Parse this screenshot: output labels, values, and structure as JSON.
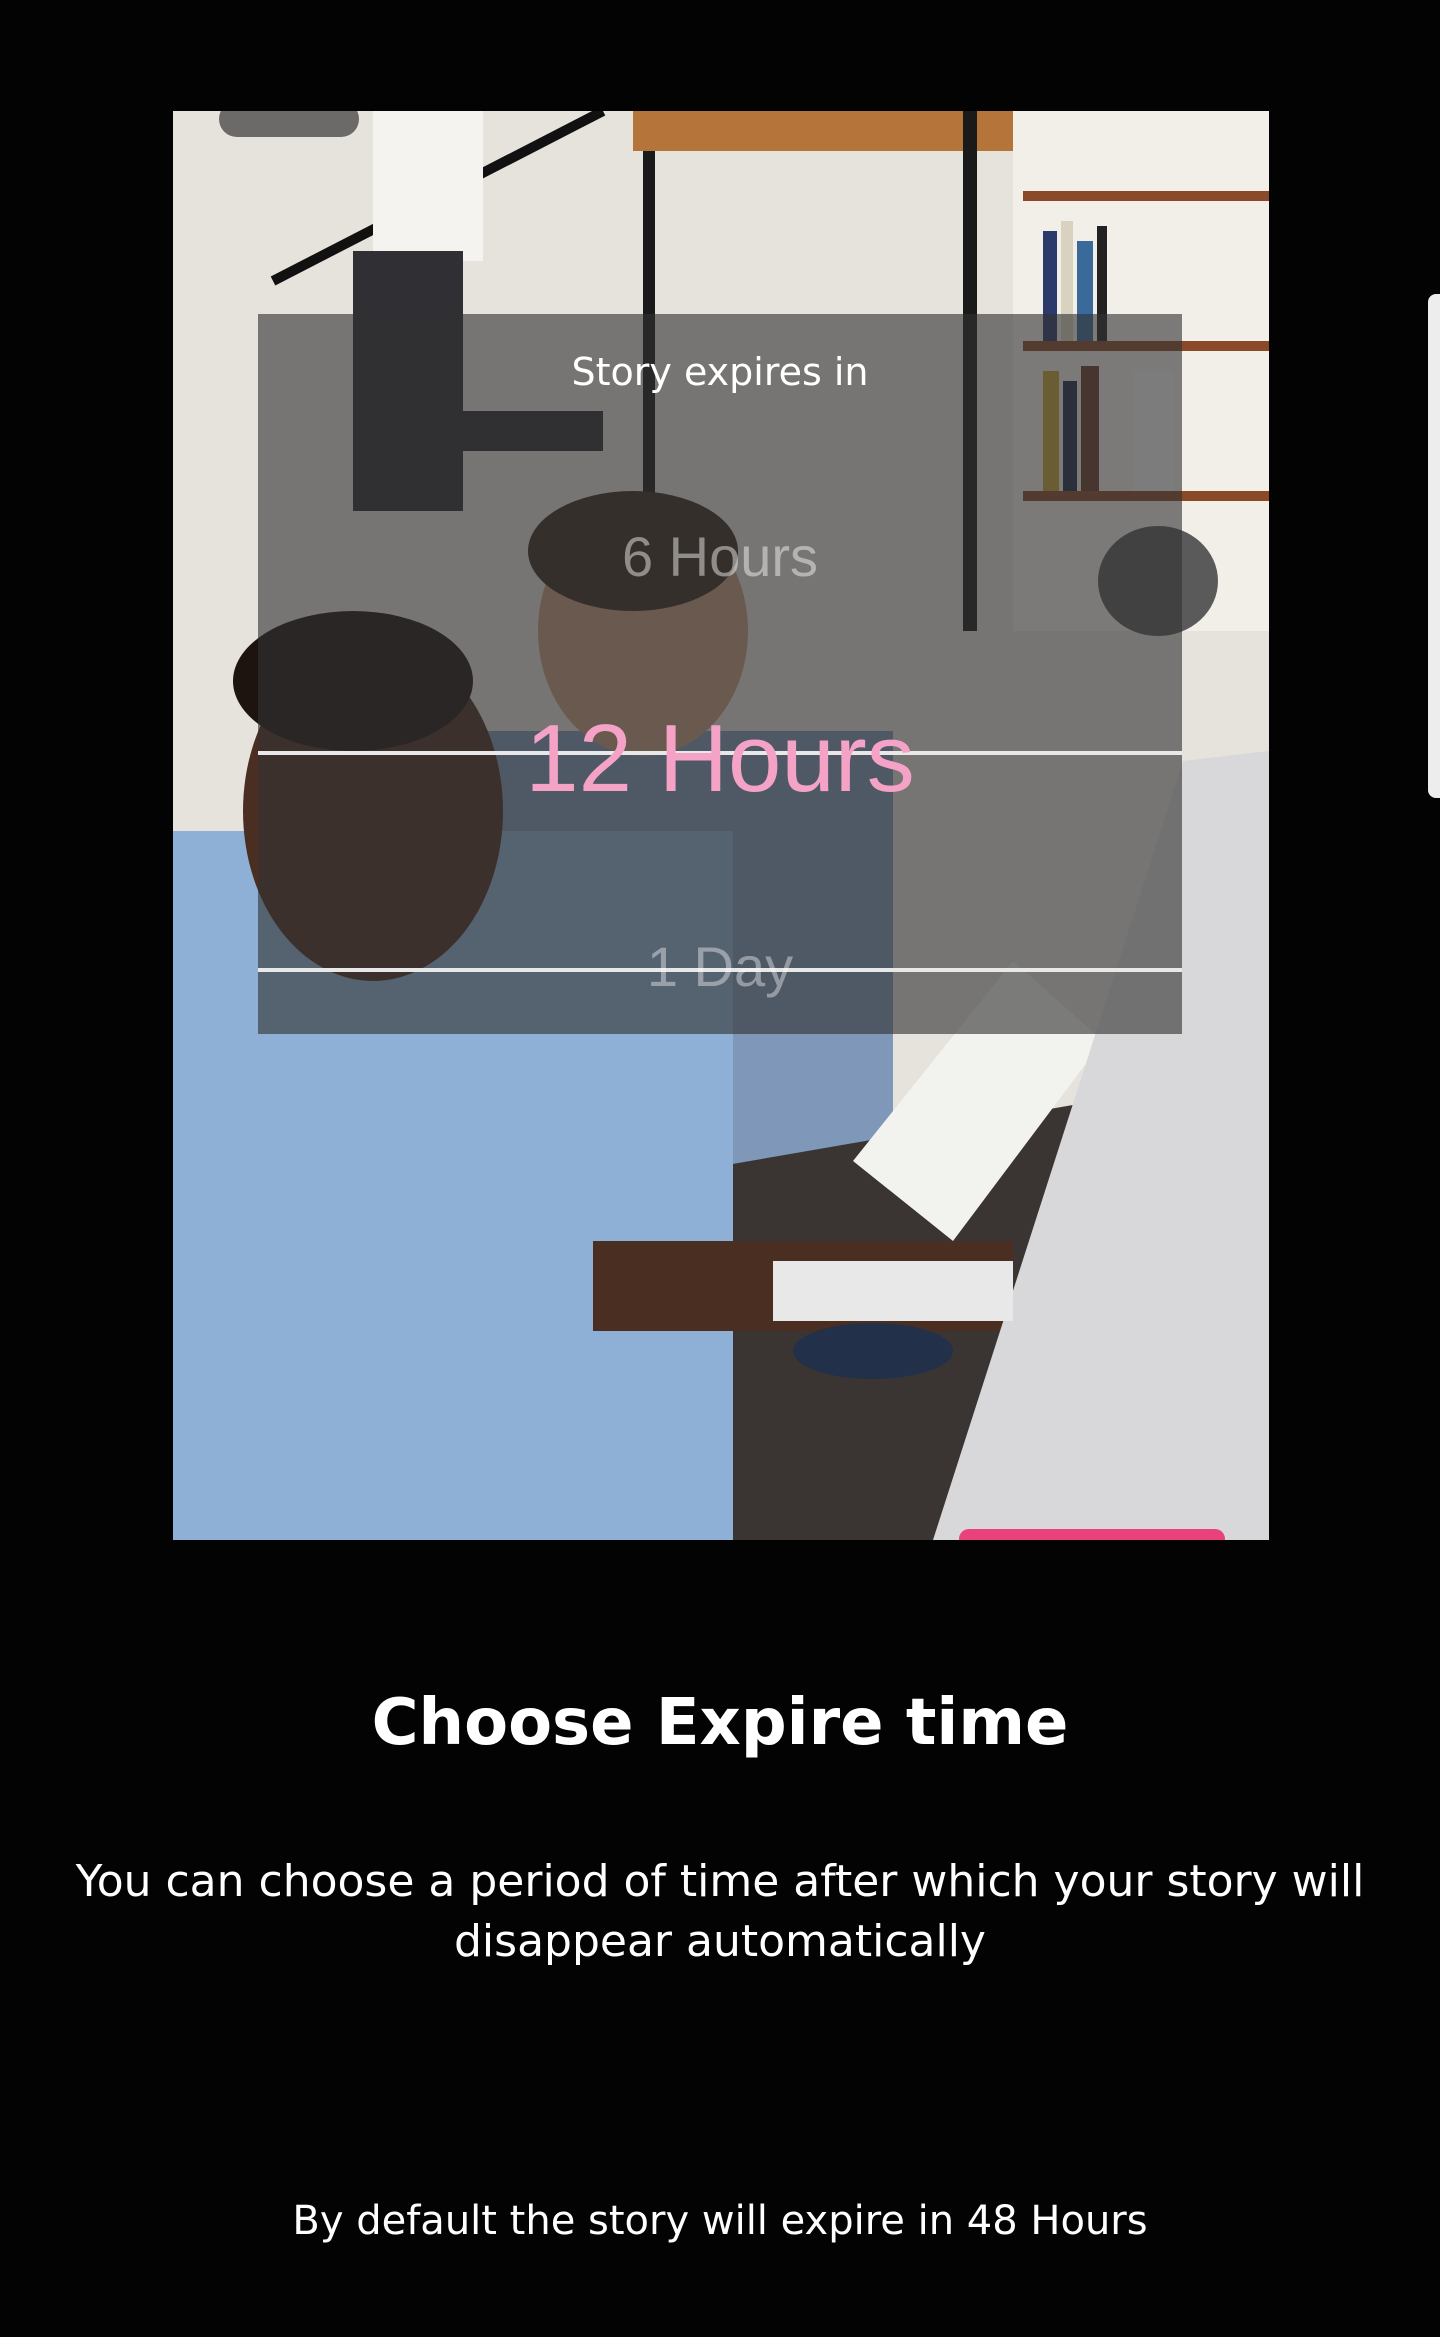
{
  "picker": {
    "title": "Story expires in",
    "options": [
      "6 Hours",
      "12 Hours",
      "1 Day"
    ],
    "selected_index": 1
  },
  "onboarding": {
    "title": "Choose Expire time",
    "description": "You can choose a period of time after which your story will disappear automatically",
    "footnote": "By default the story will expire in 48 Hours"
  },
  "colors": {
    "background": "#030303",
    "selected_option": "#f4a3c6",
    "accent": "#e8417c"
  }
}
